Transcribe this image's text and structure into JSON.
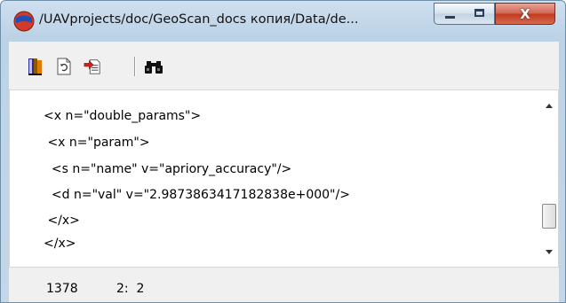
{
  "window": {
    "title": "/UAVprojects/doc/GeoScan_docs копия/Data/de...",
    "close_label": "X"
  },
  "toolbar": {
    "buttons": [
      "book-icon",
      "refresh-page-icon",
      "import-arrow-icon",
      "binoculars-icon"
    ]
  },
  "editor": {
    "lines": [
      "<x n=\"double_params\">",
      " <x n=\"param\">",
      "  <s n=\"name\" v=\"apriory_accuracy\"/>",
      "  <d n=\"val\" v=\"2.9873863417182838e+000\"/>",
      " </x>",
      "</x>"
    ]
  },
  "status": {
    "size": "1378",
    "position": "2:  2"
  }
}
